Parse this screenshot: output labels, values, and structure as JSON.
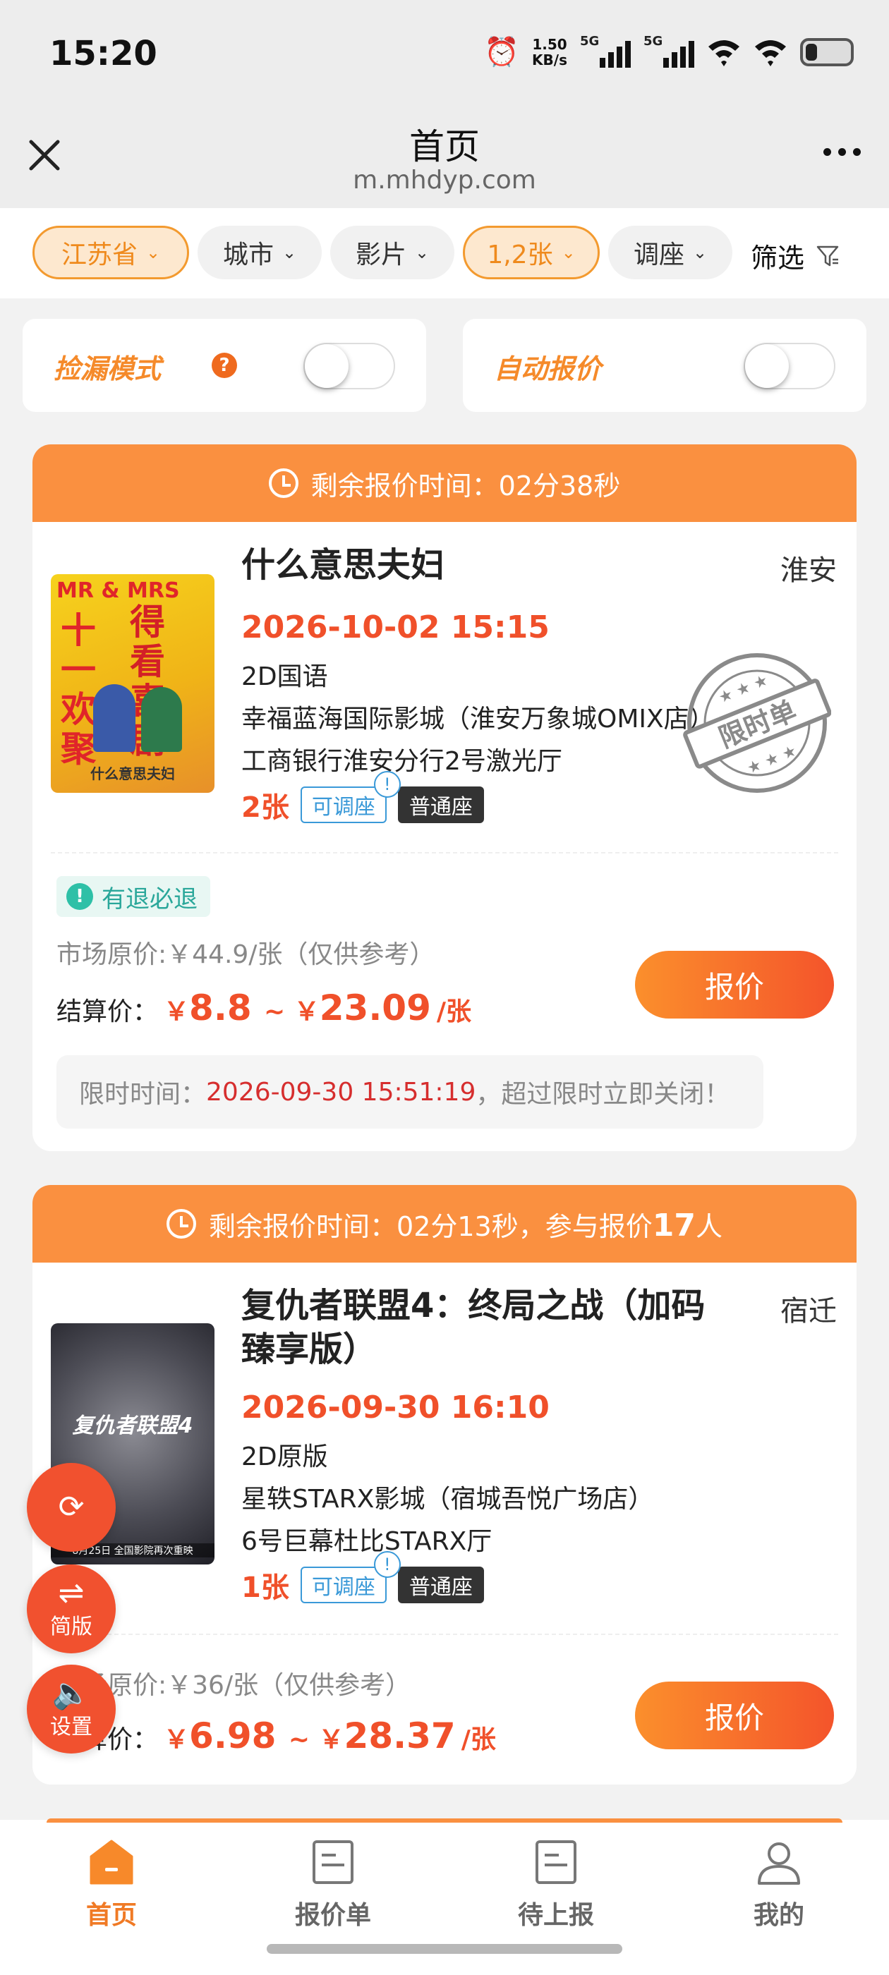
{
  "status": {
    "time": "15:20",
    "net_speed_value": "1.50",
    "net_speed_unit": "KB/s",
    "sim1": "5G",
    "sim2": "5G"
  },
  "header": {
    "title": "首页",
    "url": "m.mhdyp.com"
  },
  "filters": {
    "province": "江苏省",
    "city": "城市",
    "film": "影片",
    "tickets": "1,2张",
    "seat": "调座",
    "filter": "筛选"
  },
  "toggles": {
    "pickup_label": "捡漏模式",
    "help": "?",
    "auto_label": "自动报价"
  },
  "orders": [
    {
      "countdown_label": "剩余报价时间：",
      "countdown": "02分38秒",
      "title": "什么意思夫妇",
      "city": "淮安",
      "showtime": "2026-10-02 15:15",
      "format": "2D国语",
      "cinema": "幸福蓝海国际影城（淮安万象城OMIX店）",
      "hall": "工商银行淮安分行2号激光厅",
      "qty": "2张",
      "tag_adjust": "可调座",
      "tag_seat": "普通座",
      "refund": "有退必退",
      "market_price": "市场原价:￥44.9/张（仅供参考）",
      "settle_label": "结算价：",
      "price_low": "8.8",
      "price_high": "23.09",
      "unit": "/张",
      "quote_button": "报价",
      "deadline_label": "限时时间：",
      "deadline_time": "2026-09-30 15:51:19",
      "deadline_suffix": "，超过限时立即关闭！",
      "stamp": "限时单",
      "poster_text_1": "MR & MRS",
      "poster_text_2": "十一欢聚",
      "poster_text_3": "得看喜剧",
      "poster_text_4": "什么意思夫妇"
    },
    {
      "countdown_label": "剩余报价时间：",
      "countdown": "02分13秒",
      "participants_label": "，参与报价",
      "participants": "17",
      "participants_unit": "人",
      "title_line1": "复仇者联盟4：终局之战（加码",
      "title_line2": "臻享版）",
      "city": "宿迁",
      "showtime": "2026-09-30 16:10",
      "format": "2D原版",
      "cinema": "星轶STARX影城（宿城吾悦广场店）",
      "hall": "6号巨幕杜比STARX厅",
      "qty": "1张",
      "tag_adjust": "可调座",
      "tag_seat": "普通座",
      "market_price": "市场原价:￥36/张（仅供参考）",
      "settle_label": "结算价：",
      "price_low": "6.98",
      "price_high": "28.37",
      "unit": "/张",
      "quote_button": "报价",
      "poster_text_1": "复仇者联盟4",
      "poster_text_2": "8月25日 全国影院再次重映"
    }
  ],
  "fabs": {
    "refresh": "",
    "simple": "简版",
    "settings": "设置"
  },
  "tabs": {
    "home": "首页",
    "quotes": "报价单",
    "pending": "待上报",
    "mine": "我的"
  },
  "colors": {
    "accent": "#fa9040",
    "price": "#f0502a",
    "active_tab": "#f07a25"
  }
}
